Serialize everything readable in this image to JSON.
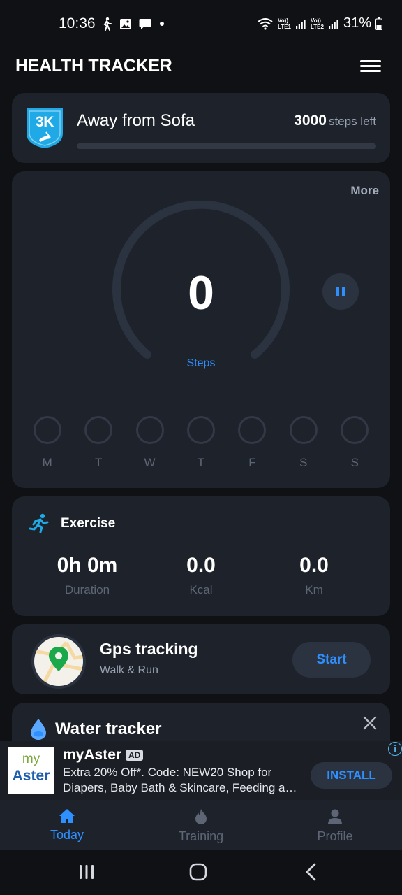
{
  "status_bar": {
    "time": "10:36",
    "battery": "31%",
    "sim1": "LTE1",
    "sim2": "LTE2",
    "volte": "Vo))"
  },
  "header": {
    "title": "HEALTH TRACKER",
    "menu_icon": "hamburger-menu-icon"
  },
  "goal": {
    "badge_label": "3K",
    "title": "Away from Sofa",
    "steps_left_value": "3000",
    "steps_left_label": "steps left",
    "progress": 0
  },
  "steps": {
    "more_label": "More",
    "count": "0",
    "label": "Steps",
    "days": [
      "M",
      "T",
      "W",
      "T",
      "F",
      "S",
      "S"
    ]
  },
  "exercise": {
    "title": "Exercise",
    "stats": [
      {
        "value": "0h 0m",
        "label": "Duration"
      },
      {
        "value": "0.0",
        "label": "Kcal"
      },
      {
        "value": "0.0",
        "label": "Km"
      }
    ]
  },
  "gps": {
    "title": "Gps tracking",
    "subtitle": "Walk & Run",
    "button": "Start"
  },
  "water": {
    "title": "Water tracker"
  },
  "ad": {
    "logo_top": "my",
    "logo_bottom": "Aster",
    "title": "myAster",
    "tag": "AD",
    "text": "Extra 20% Off*. Code: NEW20 Shop for Diapers, Baby Bath & Skincare, Feeding a…",
    "button": "INSTALL",
    "adchoices": "i"
  },
  "nav": {
    "items": [
      {
        "label": "Today",
        "icon": "home-icon",
        "active": true
      },
      {
        "label": "Training",
        "icon": "flame-icon",
        "active": false
      },
      {
        "label": "Profile",
        "icon": "person-icon",
        "active": false
      }
    ]
  },
  "colors": {
    "accent": "#2e8fff",
    "card": "#1e222a",
    "background": "#0f1115",
    "muted": "#5e6675",
    "badge": "#1fa9e6"
  }
}
